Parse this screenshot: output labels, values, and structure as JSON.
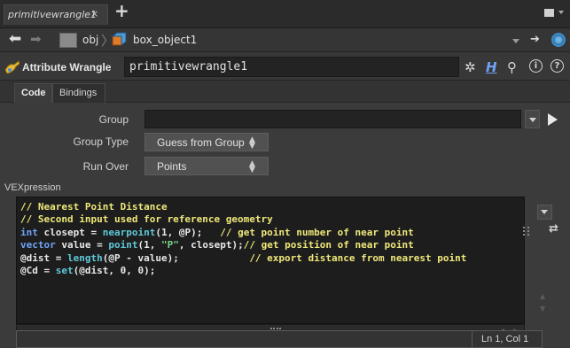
{
  "tab": {
    "title": "primitivewrangle1",
    "close": "×",
    "add": "+"
  },
  "path": {
    "obj": "obj",
    "separator": "〉",
    "node": "box_object1"
  },
  "operator": {
    "type_label": "Attribute Wrangle",
    "name": "primitivewrangle1",
    "help": "?",
    "info": "i"
  },
  "param_tabs": [
    "Code",
    "Bindings"
  ],
  "params": {
    "group_label": "Group",
    "group_value": "",
    "group_type_label": "Group Type",
    "group_type_value": "Guess from Group",
    "run_over_label": "Run Over",
    "run_over_value": "Points",
    "vex_label": "VEXpression"
  },
  "code_lines": [
    [
      {
        "c": "cmt",
        "t": "// Nearest Point Distance"
      }
    ],
    [
      {
        "c": "cmt",
        "t": "// Second input used for reference geometry"
      }
    ],
    [
      {
        "c": "kw",
        "t": "int"
      },
      {
        "c": "txt",
        "t": " closept = "
      },
      {
        "c": "fn",
        "t": "nearpoint"
      },
      {
        "c": "txt",
        "t": "(1, @P);   "
      },
      {
        "c": "cmt",
        "t": "// get point number of near point"
      }
    ],
    [
      {
        "c": "kw",
        "t": "vector"
      },
      {
        "c": "txt",
        "t": " value = "
      },
      {
        "c": "fn",
        "t": "point"
      },
      {
        "c": "txt",
        "t": "(1, "
      },
      {
        "c": "str",
        "t": "\"P\""
      },
      {
        "c": "txt",
        "t": ", closept);"
      },
      {
        "c": "cmt",
        "t": "// get position of near point"
      }
    ],
    [
      {
        "c": "txt",
        "t": "@dist = "
      },
      {
        "c": "fn",
        "t": "length"
      },
      {
        "c": "txt",
        "t": "(@P - value);            "
      },
      {
        "c": "cmt",
        "t": "// export distance from nearest point"
      }
    ],
    [
      {
        "c": "txt",
        "t": "@Cd = "
      },
      {
        "c": "fn",
        "t": "set"
      },
      {
        "c": "txt",
        "t": "(@dist, 0, 0);"
      }
    ]
  ],
  "status": {
    "cursor": "Ln 1, Col 1"
  },
  "colors": {
    "comment": "#efe87a",
    "keyword": "#6fa3f7",
    "function": "#5fc8d8",
    "string": "#7fd08a",
    "accent": "#3b8ec8"
  },
  "icons": [
    "back-arrow-icon",
    "forward-arrow-icon",
    "obj-network-icon",
    "box-object-icon",
    "pin-icon",
    "globe-icon",
    "wrangle-icon",
    "gear-icon",
    "hscript-icon",
    "search-icon",
    "info-icon",
    "help-icon",
    "select-arrow-icon",
    "expand-icon"
  ]
}
